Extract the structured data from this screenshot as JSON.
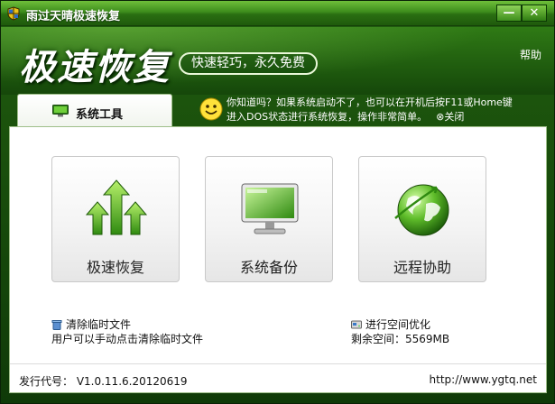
{
  "window": {
    "title": "雨过天晴极速恢复",
    "minimize_label": "—",
    "close_label": "✕"
  },
  "banner": {
    "title": "极速恢复",
    "slogan": "快速轻巧，永久免费",
    "help_label": "帮助"
  },
  "tabs": [
    {
      "label": "系统工具",
      "icon": "monitor-icon"
    }
  ],
  "tip": {
    "line1": "你知道吗？如果系统启动不了，也可以在开机后按F11或Home键",
    "line2": "进入DOS状态进行系统恢复，操作非常简单。",
    "close_label": "⊗关闭"
  },
  "tools": [
    {
      "label": "极速恢复",
      "icon": "up-arrows-icon"
    },
    {
      "label": "系统备份",
      "icon": "computer-monitor-icon"
    },
    {
      "label": "远程协助",
      "icon": "globe-icon"
    }
  ],
  "temp_files": {
    "link": "清除临时文件",
    "desc": "用户可以手动点击清除临时文件"
  },
  "space": {
    "link": "进行空间优化",
    "desc": "剩余空间：5569MB"
  },
  "footer": {
    "version": "发行代号： V1.0.11.6.20120619",
    "site": "http://www.ygtq.net"
  },
  "colors": {
    "frame_green": "#1f5a0e",
    "accent_green": "#3d8d1c"
  }
}
